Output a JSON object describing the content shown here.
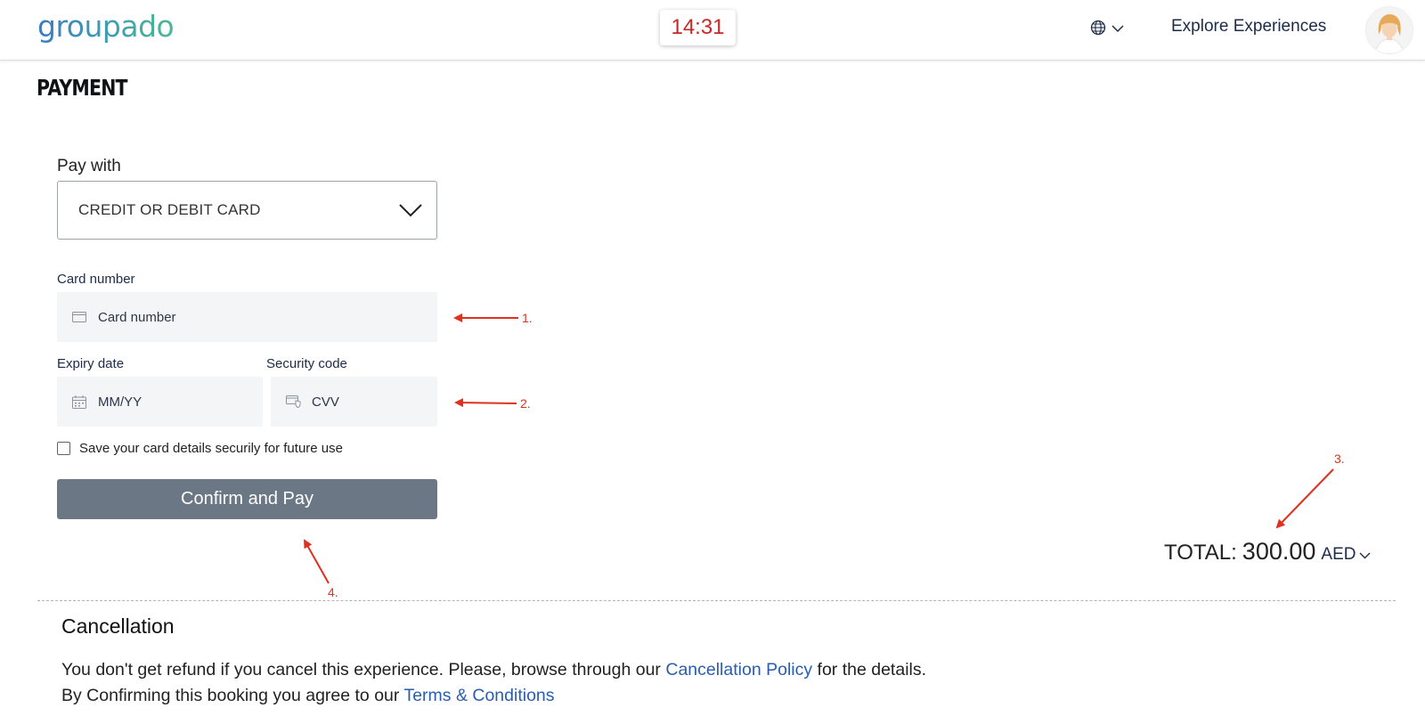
{
  "header": {
    "logo": "groupado",
    "timer": "14:31",
    "language_icon": "globe-icon",
    "explore_label": "Explore Experiences",
    "avatar_icon": "user-avatar"
  },
  "page": {
    "title": "PAYMENT"
  },
  "payment": {
    "pay_with_label": "Pay with",
    "method_selected": "CREDIT OR DEBIT CARD",
    "card_number_label": "Card number",
    "card_number_placeholder": "Card number",
    "expiry_label": "Expiry date",
    "expiry_placeholder": "MM/YY",
    "security_label": "Security code",
    "security_placeholder": "CVV",
    "save_card_label": "Save your card details securily for future use",
    "save_card_checked": false,
    "confirm_label": "Confirm and Pay"
  },
  "total": {
    "label": "TOTAL:",
    "amount": "300.00",
    "currency": "AED"
  },
  "cancellation": {
    "title": "Cancellation",
    "line1_before": "You don't get refund if you cancel this experience. Please, browse through our ",
    "line1_link": "Cancellation Policy",
    "line1_after": " for the details.",
    "line2_before": "By Confirming this booking you agree to our ",
    "line2_link": "Terms & Conditions"
  },
  "annotations": {
    "a1": "1.",
    "a2": "2.",
    "a3": "3.",
    "a4": "4."
  },
  "colors": {
    "accent_link": "#2a5db0",
    "button_bg": "#6b7785",
    "timer_text": "#c62828",
    "annotation": "#e0301e"
  }
}
